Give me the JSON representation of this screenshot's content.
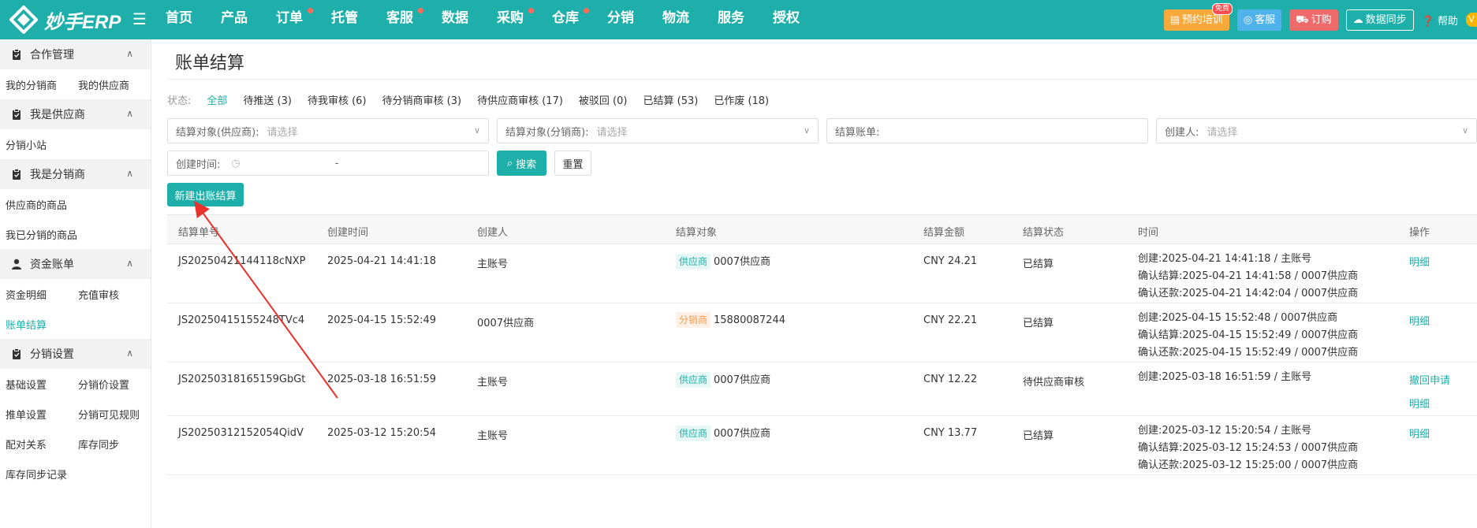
{
  "header": {
    "logo_text": "妙手ERP",
    "nav": [
      {
        "label": "首页",
        "dot": false
      },
      {
        "label": "产品",
        "dot": false
      },
      {
        "label": "订单",
        "dot": true
      },
      {
        "label": "托管",
        "dot": false
      },
      {
        "label": "客服",
        "dot": true
      },
      {
        "label": "数据",
        "dot": false
      },
      {
        "label": "采购",
        "dot": true
      },
      {
        "label": "仓库",
        "dot": true
      },
      {
        "label": "分销",
        "dot": false
      },
      {
        "label": "物流",
        "dot": false
      },
      {
        "label": "服务",
        "dot": false
      },
      {
        "label": "授权",
        "dot": false
      }
    ],
    "training_label": "预约培训",
    "free_badge": "免费",
    "service_label": "客服",
    "order_label": "订购",
    "sync_label": "数据同步",
    "help_label": "帮助",
    "avatar_text": "V"
  },
  "sidebar": {
    "groups": [
      {
        "title": "合作管理",
        "icon": "clipboard-icon",
        "items": [
          "我的分销商",
          "我的供应商"
        ]
      },
      {
        "title": "我是供应商",
        "icon": "clipboard-icon",
        "items": [
          "分销小站"
        ]
      },
      {
        "title": "我是分销商",
        "icon": "clipboard-icon",
        "items": [
          "供应商的商品",
          "我已分销的商品"
        ]
      },
      {
        "title": "资金账单",
        "icon": "user-icon",
        "items": [
          "资金明细",
          "充值审核",
          "账单结算"
        ]
      },
      {
        "title": "分销设置",
        "icon": "clipboard-icon",
        "items": [
          "基础设置",
          "分销价设置",
          "推单设置",
          "分销可见规则",
          "配对关系",
          "库存同步",
          "库存同步记录"
        ]
      }
    ],
    "active_item": "账单结算"
  },
  "page": {
    "title": "账单结算",
    "status_label": "状态:",
    "status_tabs": [
      "全部",
      "待推送 (3)",
      "待我审核 (6)",
      "待分销商审核 (3)",
      "待供应商审核 (17)",
      "被驳回 (0)",
      "已结算 (53)",
      "已作废 (18)"
    ],
    "filters": {
      "supplier_label": "结算对象(供应商):",
      "supplier_placeholder": "请选择",
      "distributor_label": "结算对象(分销商):",
      "distributor_placeholder": "请选择",
      "bill_label": "结算账单:",
      "creator_label": "创建人:",
      "creator_placeholder": "请选择",
      "created_label": "创建时间:",
      "date_separator": "-"
    },
    "search_label": "搜索",
    "reset_label": "重置",
    "new_label": "新建出账结算"
  },
  "table": {
    "headers": [
      "结算单号",
      "创建时间",
      "创建人",
      "结算对象",
      "结算金额",
      "结算状态",
      "时间",
      "操作"
    ],
    "rows": [
      {
        "id": "JS20250421144118cNXP",
        "created": "2025-04-21 14:41:18",
        "creator": "主账号",
        "target_type": "供应商",
        "target": "0007供应商",
        "amount": "CNY 24.21",
        "status": "已结算",
        "times": [
          "创建:2025-04-21 14:41:18 / 主账号",
          "确认结算:2025-04-21 14:41:58 / 0007供应商",
          "确认还款:2025-04-21 14:42:04 / 0007供应商"
        ],
        "ops": [
          "明细"
        ]
      },
      {
        "id": "JS20250415155248TVc4",
        "created": "2025-04-15 15:52:49",
        "creator": "0007供应商",
        "target_type": "分销商",
        "target": "15880087244",
        "amount": "CNY 22.21",
        "status": "已结算",
        "times": [
          "创建:2025-04-15 15:52:48 / 0007供应商",
          "确认结算:2025-04-15 15:52:49 / 0007供应商",
          "确认还款:2025-04-15 15:52:49 / 0007供应商"
        ],
        "ops": [
          "明细"
        ]
      },
      {
        "id": "JS20250318165159GbGt",
        "created": "2025-03-18 16:51:59",
        "creator": "主账号",
        "target_type": "供应商",
        "target": "0007供应商",
        "amount": "CNY 12.22",
        "status": "待供应商审核",
        "times": [
          "创建:2025-03-18 16:51:59 / 主账号"
        ],
        "ops": [
          "撤回申请",
          "明细"
        ]
      },
      {
        "id": "JS20250312152054QidV",
        "created": "2025-03-12 15:20:54",
        "creator": "主账号",
        "target_type": "供应商",
        "target": "0007供应商",
        "amount": "CNY 13.77",
        "status": "已结算",
        "times": [
          "创建:2025-03-12 15:20:54 / 主账号",
          "确认结算:2025-03-12 15:24:53 / 0007供应商",
          "确认还款:2025-03-12 15:25:00 / 0007供应商"
        ],
        "ops": [
          "明细"
        ]
      }
    ]
  },
  "colors": {
    "primary": "#1eafaa",
    "annotation_arrow": "#e8322d"
  }
}
